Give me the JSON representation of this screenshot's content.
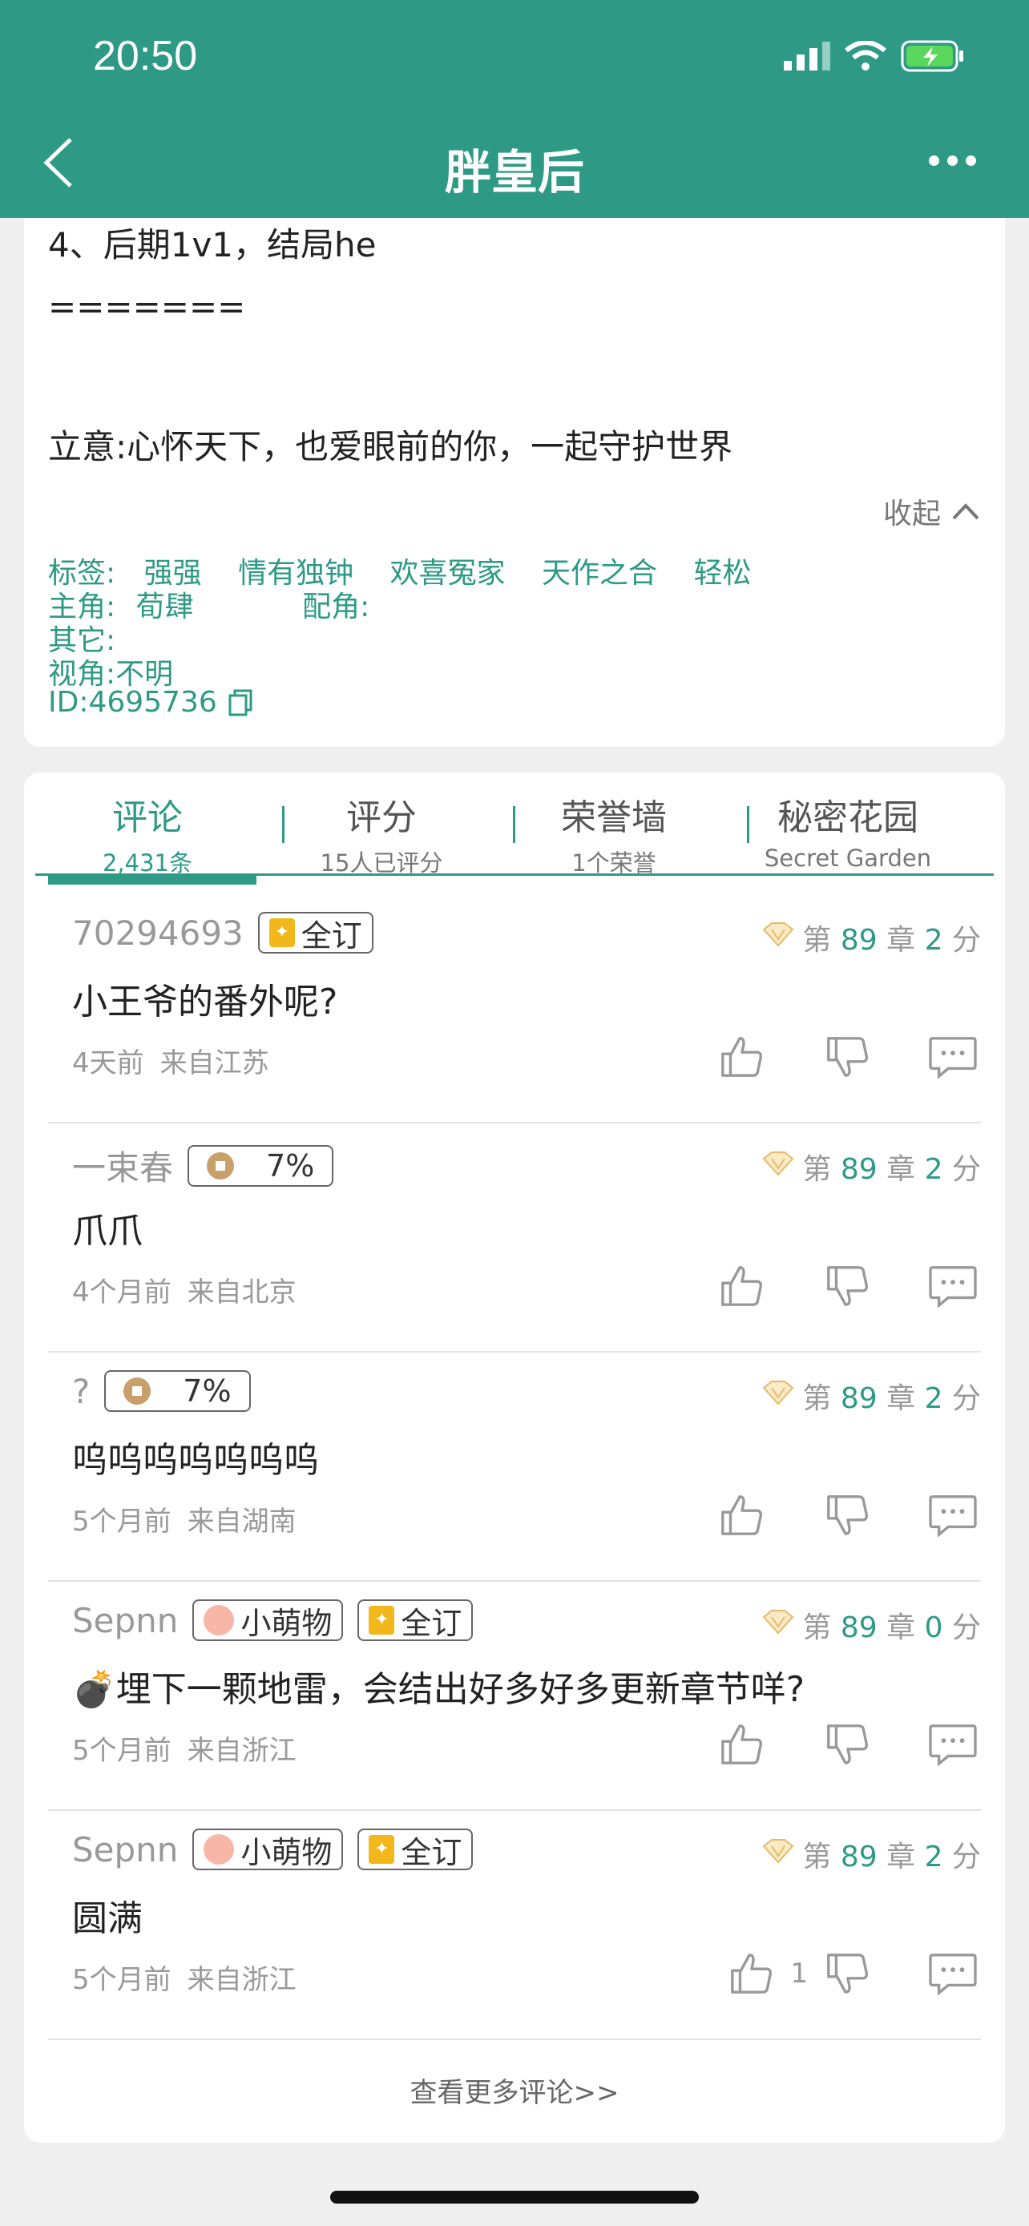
{
  "status": {
    "time": "20:50"
  },
  "nav": {
    "title": "胖皇后"
  },
  "description": {
    "line1": "4、后期1v1，结局he",
    "line2": "=======",
    "line3": "立意:心怀天下，也爱眼前的你，一起守护世界",
    "collapse": "收起"
  },
  "meta": {
    "tags_label": "标签:",
    "tags": [
      "强强",
      "情有独钟",
      "欢喜冤家",
      "天作之合",
      "轻松"
    ],
    "lead_label": "主角:",
    "lead": "荀肆",
    "support_label": "配角:",
    "other_label": "其它:",
    "pov": "视角:不明",
    "id": "ID:4695736"
  },
  "tabs": [
    {
      "label": "评论",
      "sub": "2,431条"
    },
    {
      "label": "评分",
      "sub": "15人已评分"
    },
    {
      "label": "荣誉墙",
      "sub": "1个荣誉"
    },
    {
      "label": "秘密花园",
      "sub": "Secret Garden"
    }
  ],
  "comments": [
    {
      "user": "70294693",
      "badges": [
        {
          "type": "sub",
          "text": "全订"
        }
      ],
      "chap_prefix": "第",
      "chapter": "89",
      "chap_mid": "章",
      "score": "2",
      "score_suffix": "分",
      "text": "小王爷的番外呢?",
      "time": "4天前",
      "loc": "来自江苏",
      "likes": ""
    },
    {
      "user": "一束春",
      "badges": [
        {
          "type": "coin",
          "text": "7%"
        }
      ],
      "chap_prefix": "第",
      "chapter": "89",
      "chap_mid": "章",
      "score": "2",
      "score_suffix": "分",
      "text": "爪爪",
      "time": "4个月前",
      "loc": "来自北京",
      "likes": ""
    },
    {
      "user": "?",
      "badges": [
        {
          "type": "coin",
          "text": "7%"
        }
      ],
      "chap_prefix": "第",
      "chapter": "89",
      "chap_mid": "章",
      "score": "2",
      "score_suffix": "分",
      "text": "呜呜呜呜呜呜呜",
      "time": "5个月前",
      "loc": "来自湖南",
      "likes": ""
    },
    {
      "user": "Sepnn",
      "badges": [
        {
          "type": "paw",
          "text": "小萌物"
        },
        {
          "type": "sub",
          "text": "全订"
        }
      ],
      "chap_prefix": "第",
      "chapter": "89",
      "chap_mid": "章",
      "score": "0",
      "score_suffix": "分",
      "text": "💣埋下一颗地雷，会结出好多好多更新章节咩?",
      "time": "5个月前",
      "loc": "来自浙江",
      "likes": ""
    },
    {
      "user": "Sepnn",
      "badges": [
        {
          "type": "paw",
          "text": "小萌物"
        },
        {
          "type": "sub",
          "text": "全订"
        }
      ],
      "chap_prefix": "第",
      "chapter": "89",
      "chap_mid": "章",
      "score": "2",
      "score_suffix": "分",
      "text": "圆满",
      "time": "5个月前",
      "loc": "来自浙江",
      "likes": "1"
    }
  ],
  "more_comments": "查看更多评论>>",
  "colors": {
    "brand": "#2e9a86"
  }
}
